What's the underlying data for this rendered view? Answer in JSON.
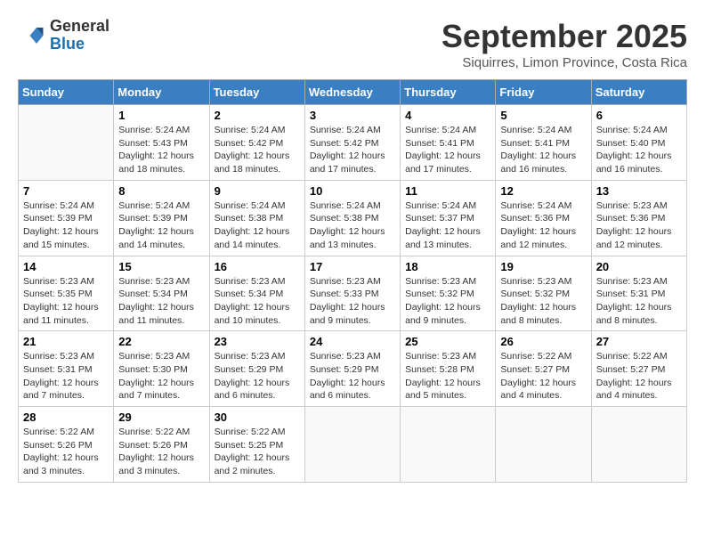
{
  "header": {
    "logo_general": "General",
    "logo_blue": "Blue",
    "month_title": "September 2025",
    "subtitle": "Siquirres, Limon Province, Costa Rica"
  },
  "days_of_week": [
    "Sunday",
    "Monday",
    "Tuesday",
    "Wednesday",
    "Thursday",
    "Friday",
    "Saturday"
  ],
  "weeks": [
    [
      {
        "day": "",
        "info": ""
      },
      {
        "day": "1",
        "info": "Sunrise: 5:24 AM\nSunset: 5:43 PM\nDaylight: 12 hours\nand 18 minutes."
      },
      {
        "day": "2",
        "info": "Sunrise: 5:24 AM\nSunset: 5:42 PM\nDaylight: 12 hours\nand 18 minutes."
      },
      {
        "day": "3",
        "info": "Sunrise: 5:24 AM\nSunset: 5:42 PM\nDaylight: 12 hours\nand 17 minutes."
      },
      {
        "day": "4",
        "info": "Sunrise: 5:24 AM\nSunset: 5:41 PM\nDaylight: 12 hours\nand 17 minutes."
      },
      {
        "day": "5",
        "info": "Sunrise: 5:24 AM\nSunset: 5:41 PM\nDaylight: 12 hours\nand 16 minutes."
      },
      {
        "day": "6",
        "info": "Sunrise: 5:24 AM\nSunset: 5:40 PM\nDaylight: 12 hours\nand 16 minutes."
      }
    ],
    [
      {
        "day": "7",
        "info": "Sunrise: 5:24 AM\nSunset: 5:39 PM\nDaylight: 12 hours\nand 15 minutes."
      },
      {
        "day": "8",
        "info": "Sunrise: 5:24 AM\nSunset: 5:39 PM\nDaylight: 12 hours\nand 14 minutes."
      },
      {
        "day": "9",
        "info": "Sunrise: 5:24 AM\nSunset: 5:38 PM\nDaylight: 12 hours\nand 14 minutes."
      },
      {
        "day": "10",
        "info": "Sunrise: 5:24 AM\nSunset: 5:38 PM\nDaylight: 12 hours\nand 13 minutes."
      },
      {
        "day": "11",
        "info": "Sunrise: 5:24 AM\nSunset: 5:37 PM\nDaylight: 12 hours\nand 13 minutes."
      },
      {
        "day": "12",
        "info": "Sunrise: 5:24 AM\nSunset: 5:36 PM\nDaylight: 12 hours\nand 12 minutes."
      },
      {
        "day": "13",
        "info": "Sunrise: 5:23 AM\nSunset: 5:36 PM\nDaylight: 12 hours\nand 12 minutes."
      }
    ],
    [
      {
        "day": "14",
        "info": "Sunrise: 5:23 AM\nSunset: 5:35 PM\nDaylight: 12 hours\nand 11 minutes."
      },
      {
        "day": "15",
        "info": "Sunrise: 5:23 AM\nSunset: 5:34 PM\nDaylight: 12 hours\nand 11 minutes."
      },
      {
        "day": "16",
        "info": "Sunrise: 5:23 AM\nSunset: 5:34 PM\nDaylight: 12 hours\nand 10 minutes."
      },
      {
        "day": "17",
        "info": "Sunrise: 5:23 AM\nSunset: 5:33 PM\nDaylight: 12 hours\nand 9 minutes."
      },
      {
        "day": "18",
        "info": "Sunrise: 5:23 AM\nSunset: 5:32 PM\nDaylight: 12 hours\nand 9 minutes."
      },
      {
        "day": "19",
        "info": "Sunrise: 5:23 AM\nSunset: 5:32 PM\nDaylight: 12 hours\nand 8 minutes."
      },
      {
        "day": "20",
        "info": "Sunrise: 5:23 AM\nSunset: 5:31 PM\nDaylight: 12 hours\nand 8 minutes."
      }
    ],
    [
      {
        "day": "21",
        "info": "Sunrise: 5:23 AM\nSunset: 5:31 PM\nDaylight: 12 hours\nand 7 minutes."
      },
      {
        "day": "22",
        "info": "Sunrise: 5:23 AM\nSunset: 5:30 PM\nDaylight: 12 hours\nand 7 minutes."
      },
      {
        "day": "23",
        "info": "Sunrise: 5:23 AM\nSunset: 5:29 PM\nDaylight: 12 hours\nand 6 minutes."
      },
      {
        "day": "24",
        "info": "Sunrise: 5:23 AM\nSunset: 5:29 PM\nDaylight: 12 hours\nand 6 minutes."
      },
      {
        "day": "25",
        "info": "Sunrise: 5:23 AM\nSunset: 5:28 PM\nDaylight: 12 hours\nand 5 minutes."
      },
      {
        "day": "26",
        "info": "Sunrise: 5:22 AM\nSunset: 5:27 PM\nDaylight: 12 hours\nand 4 minutes."
      },
      {
        "day": "27",
        "info": "Sunrise: 5:22 AM\nSunset: 5:27 PM\nDaylight: 12 hours\nand 4 minutes."
      }
    ],
    [
      {
        "day": "28",
        "info": "Sunrise: 5:22 AM\nSunset: 5:26 PM\nDaylight: 12 hours\nand 3 minutes."
      },
      {
        "day": "29",
        "info": "Sunrise: 5:22 AM\nSunset: 5:26 PM\nDaylight: 12 hours\nand 3 minutes."
      },
      {
        "day": "30",
        "info": "Sunrise: 5:22 AM\nSunset: 5:25 PM\nDaylight: 12 hours\nand 2 minutes."
      },
      {
        "day": "",
        "info": ""
      },
      {
        "day": "",
        "info": ""
      },
      {
        "day": "",
        "info": ""
      },
      {
        "day": "",
        "info": ""
      }
    ]
  ]
}
